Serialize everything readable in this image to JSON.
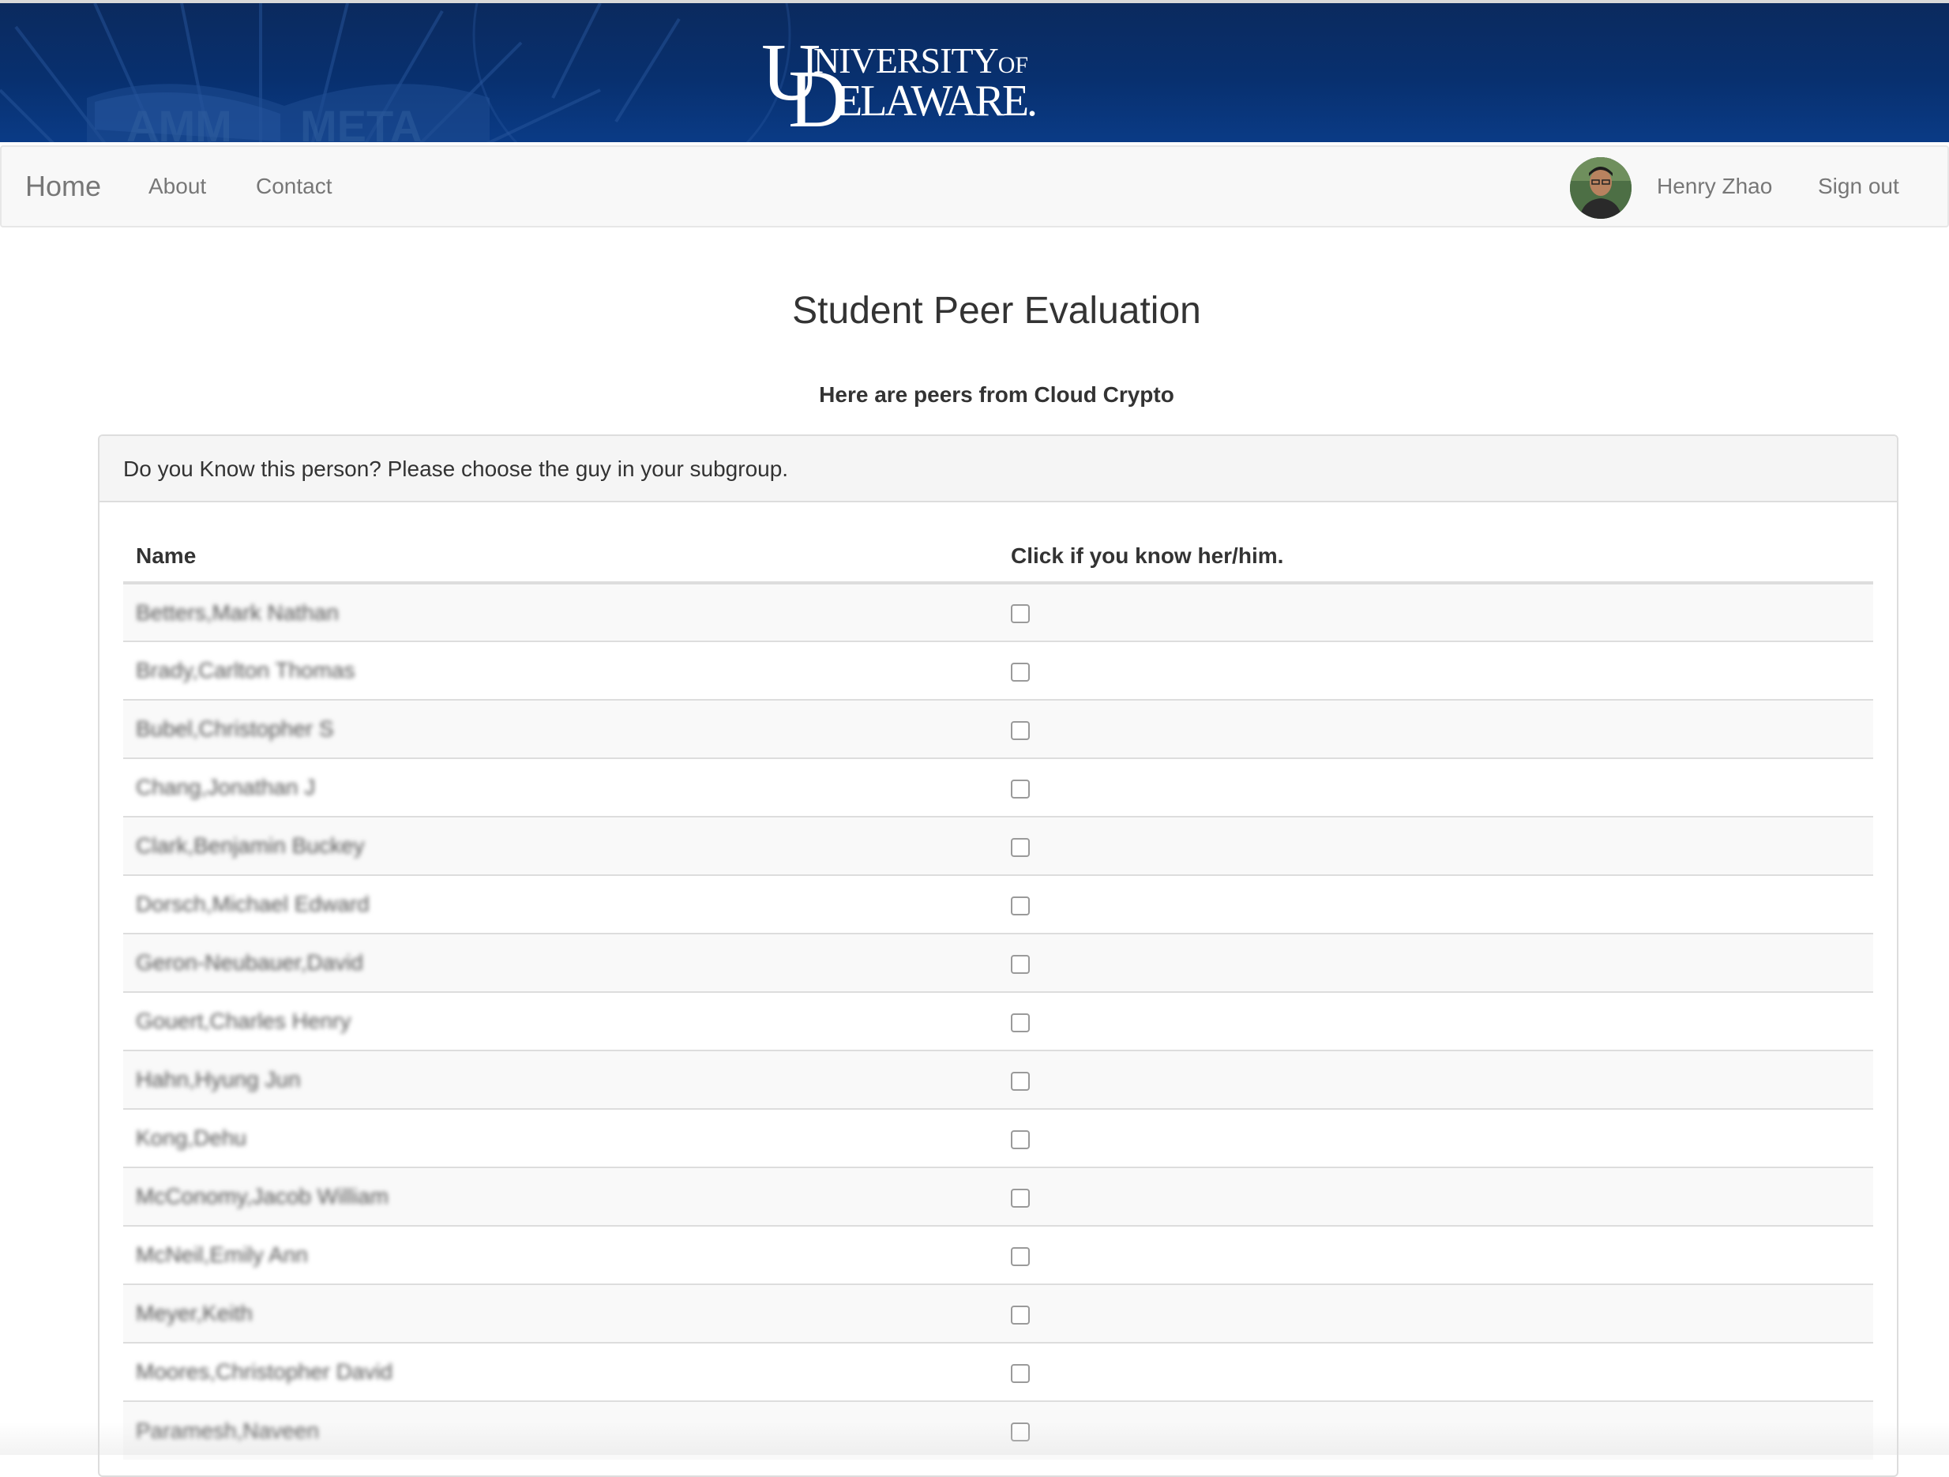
{
  "banner": {
    "logo_line1": "NIVERSITY",
    "logo_of": "OF",
    "logo_line2": "ELAWARE.",
    "logo_u": "U",
    "logo_d": "D",
    "background_color": "#08306f"
  },
  "navbar": {
    "brand": "Home",
    "links": [
      "About",
      "Contact"
    ],
    "user_name": "Henry Zhao",
    "sign_out": "Sign out"
  },
  "page": {
    "title": "Student Peer Evaluation",
    "subtitle": "Here are peers from Cloud Crypto"
  },
  "panel": {
    "heading": "Do you Know this person? Please choose the guy in your subgroup.",
    "columns": [
      "Name",
      "Click if you know her/him."
    ],
    "rows": [
      {
        "name": "Betters,Mark Nathan",
        "checked": false
      },
      {
        "name": "Brady,Carlton Thomas",
        "checked": false
      },
      {
        "name": "Bubel,Christopher S",
        "checked": false
      },
      {
        "name": "Chang,Jonathan J",
        "checked": false
      },
      {
        "name": "Clark,Benjamin Buckey",
        "checked": false
      },
      {
        "name": "Dorsch,Michael Edward",
        "checked": false
      },
      {
        "name": "Geron-Neubauer,David",
        "checked": false
      },
      {
        "name": "Gouert,Charles Henry",
        "checked": false
      },
      {
        "name": "Hahn,Hyung Jun",
        "checked": false
      },
      {
        "name": "Kong,Dehu",
        "checked": false
      },
      {
        "name": "McConomy,Jacob William",
        "checked": false
      },
      {
        "name": "McNeil,Emily Ann",
        "checked": false
      },
      {
        "name": "Meyer,Keith",
        "checked": false
      },
      {
        "name": "Moores,Christopher David",
        "checked": false
      },
      {
        "name": "Paramesh,Naveen",
        "checked": false
      }
    ]
  }
}
